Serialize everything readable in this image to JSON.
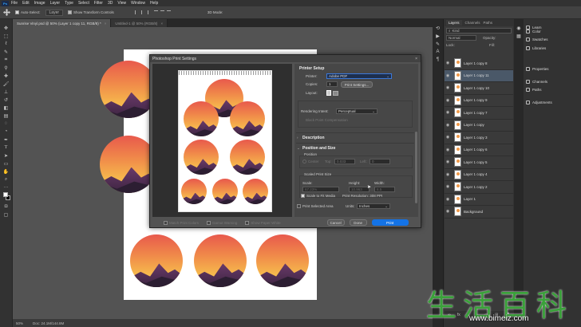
{
  "menubar": {
    "app_icon": "Ps",
    "items": [
      "File",
      "Edit",
      "Image",
      "Layer",
      "Type",
      "Select",
      "Filter",
      "3D",
      "View",
      "Window",
      "Help"
    ]
  },
  "optionsbar": {
    "move_tool_icon": "move-icon",
    "auto_select_label": "Auto-Select:",
    "auto_select_value": "Layer",
    "show_transform_label": "Show Transform Controls",
    "mode_3d_label": "3D Mode:"
  },
  "tabs": [
    {
      "label": "Sunrise Vinyl.psd @ 50% (Layer 1 copy 11, RGB/8) *",
      "active": true
    },
    {
      "label": "Untitled-1 @ 50% (RGB/8)",
      "active": false
    }
  ],
  "statusbar": {
    "zoom": "50%",
    "doc": "Doc: 24.1M/144.8M"
  },
  "dialog": {
    "title": "Photoshop Print Settings",
    "printer_setup": {
      "header": "Printer Setup",
      "printer_label": "Printer:",
      "printer_value": "Adobe PDF",
      "copies_label": "Copies:",
      "copies_value": "1",
      "print_settings_label": "Print Settings...",
      "layout_label": "Layout:"
    },
    "rendering_intent_label": "Rendering Intent:",
    "rendering_intent_value": "Perceptual",
    "black_point_label": "Black Point Compensation",
    "description_header": "Description",
    "position_size": {
      "header": "Position and Size",
      "position_label": "Position",
      "center_label": "Center",
      "top_label": "Top:",
      "top_value": "0.033",
      "left_label": "Left:",
      "left_value": "0",
      "scaled_label": "Scaled Print Size",
      "scale_label": "Scale:",
      "scale_value": "67.23%",
      "height_label": "Height:",
      "height_value": "10.963",
      "width_label": "Width:",
      "width_value": "8.5",
      "scale_to_fit_label": "Scale to Fit Media",
      "resolution_label": "Print Resolution: 308 PPI",
      "print_area_label": "Print Selected Area",
      "units_label": "Units:",
      "units_value": "Inches"
    },
    "footer": {
      "match_colors": "Match Print Colors",
      "gamut_warning": "Gamut Warning",
      "paper_white": "Show Paper White",
      "cancel": "Cancel",
      "done": "Done",
      "print": "Print"
    }
  },
  "layers_panel": {
    "tabs": [
      "Layers",
      "Channels",
      "Paths"
    ],
    "kind_label": "Kind",
    "blend_mode": "Normal",
    "opacity_label": "Opacity:",
    "lock_label": "Lock:",
    "fill_label": "Fill:",
    "layers": [
      {
        "name": "Layer 1 copy 8",
        "selected": false
      },
      {
        "name": "Layer 1 copy 11",
        "selected": true
      },
      {
        "name": "Layer 1 copy 10",
        "selected": false
      },
      {
        "name": "Layer 1 copy 9",
        "selected": false
      },
      {
        "name": "Layer 1 copy 7",
        "selected": false
      },
      {
        "name": "Layer 1 copy",
        "selected": false
      },
      {
        "name": "Layer 1 copy 3",
        "selected": false
      },
      {
        "name": "Layer 1 copy 6",
        "selected": false
      },
      {
        "name": "Layer 1 copy 5",
        "selected": false
      },
      {
        "name": "Layer 1 copy 4",
        "selected": false
      },
      {
        "name": "Layer 1 copy 2",
        "selected": false
      },
      {
        "name": "Layer 1",
        "selected": false
      },
      {
        "name": "Background",
        "selected": false
      }
    ]
  },
  "right_panels": [
    {
      "label": "Color",
      "icon": "color-icon"
    },
    {
      "label": "Swatches",
      "icon": "swatches-icon"
    },
    {
      "label": "Libraries",
      "icon": "libraries-icon"
    },
    {
      "label": "Properties",
      "icon": "properties-icon"
    },
    {
      "label": "Channels",
      "icon": "channels-icon"
    },
    {
      "label": "Paths",
      "icon": "paths-icon"
    },
    {
      "label": "Adjustments",
      "icon": "adjustments-icon"
    }
  ],
  "learn_label": "Learn",
  "watermark": {
    "cn": "生活百科",
    "url": "www.bimeiz.com"
  },
  "colors": {
    "ui_dark": "#323232",
    "canvas_bg": "#535353",
    "accent_blue": "#1473e6",
    "sunset_orange": "#f08a4a",
    "mountain_purple": "#4a2c4e",
    "watermark_green": "#3aa13a"
  }
}
